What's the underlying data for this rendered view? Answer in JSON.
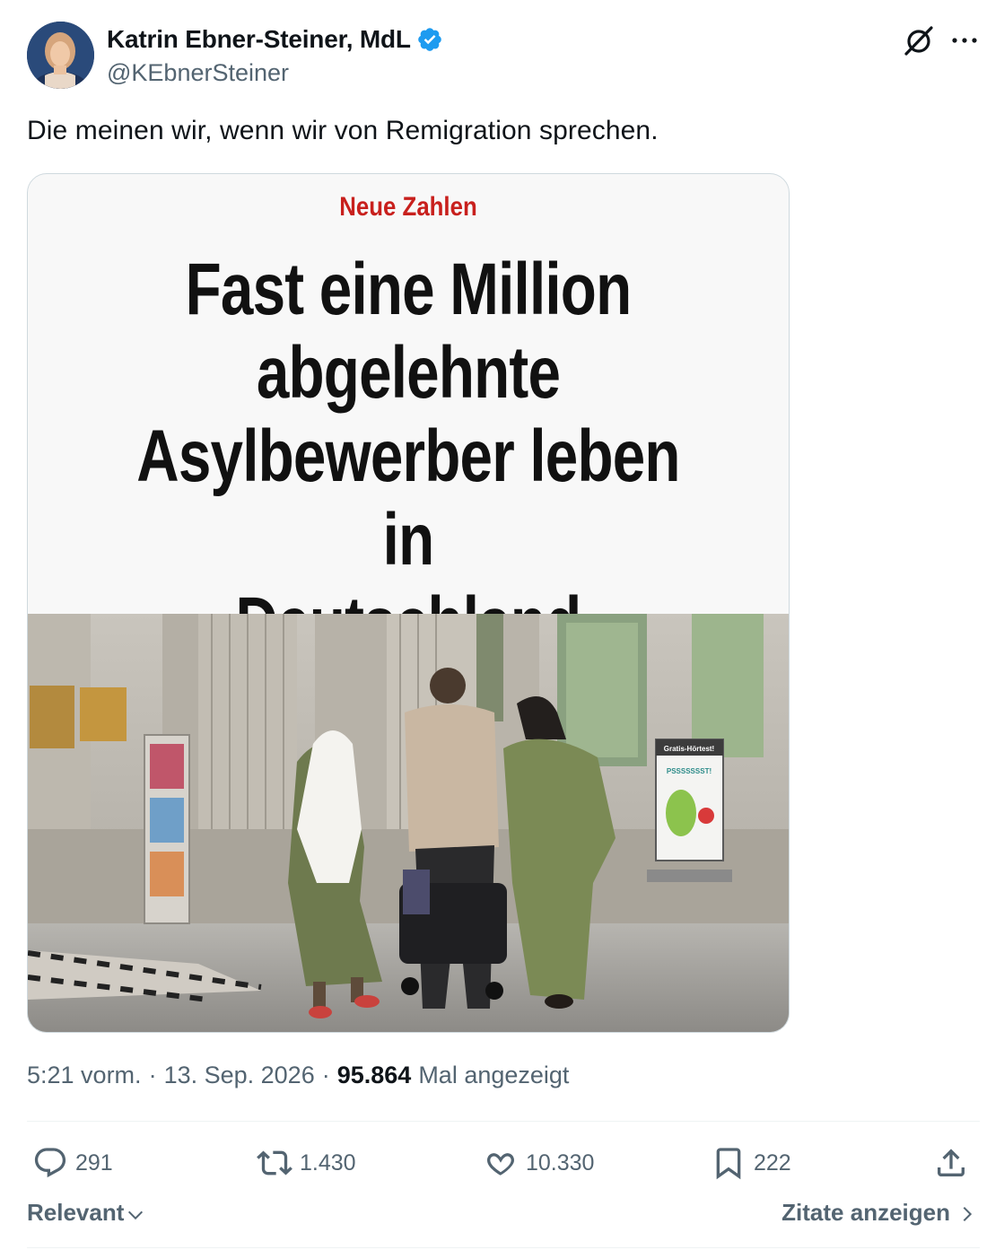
{
  "author": {
    "name": "Katrin Ebner-Steiner, MdL",
    "handle": "@KEbnerSteiner"
  },
  "tweet": {
    "text": "Die meinen wir, wenn wir von Remigration sprechen."
  },
  "media": {
    "kicker": "Neue Zahlen",
    "headline_lines": [
      "Fast eine Million",
      "abgelehnte",
      "Asylbewerber leben in",
      "Deutschland"
    ],
    "photo_sign_title": "Gratis-Hörtest!",
    "photo_sign_text": "PSSSSSSST!"
  },
  "meta": {
    "time": "5:21 vorm.",
    "date": "13. Sep. 2026",
    "views_count": "95.864",
    "views_label": "Mal angezeigt",
    "separator": "·"
  },
  "actions": {
    "replies": "291",
    "reposts": "1.430",
    "likes": "10.330",
    "bookmarks": "222"
  },
  "footer": {
    "sort_label": "Relevant",
    "quotes_label": "Zitate anzeigen"
  },
  "colors": {
    "verified": "#1d9bf0",
    "secondary_text": "#536471",
    "kicker_red": "#c8201d"
  },
  "icons": [
    "verified-badge-icon",
    "grok-icon",
    "more-icon",
    "reply-icon",
    "repost-icon",
    "like-icon",
    "bookmark-icon",
    "share-icon",
    "chevron-down-icon",
    "chevron-right-icon"
  ]
}
